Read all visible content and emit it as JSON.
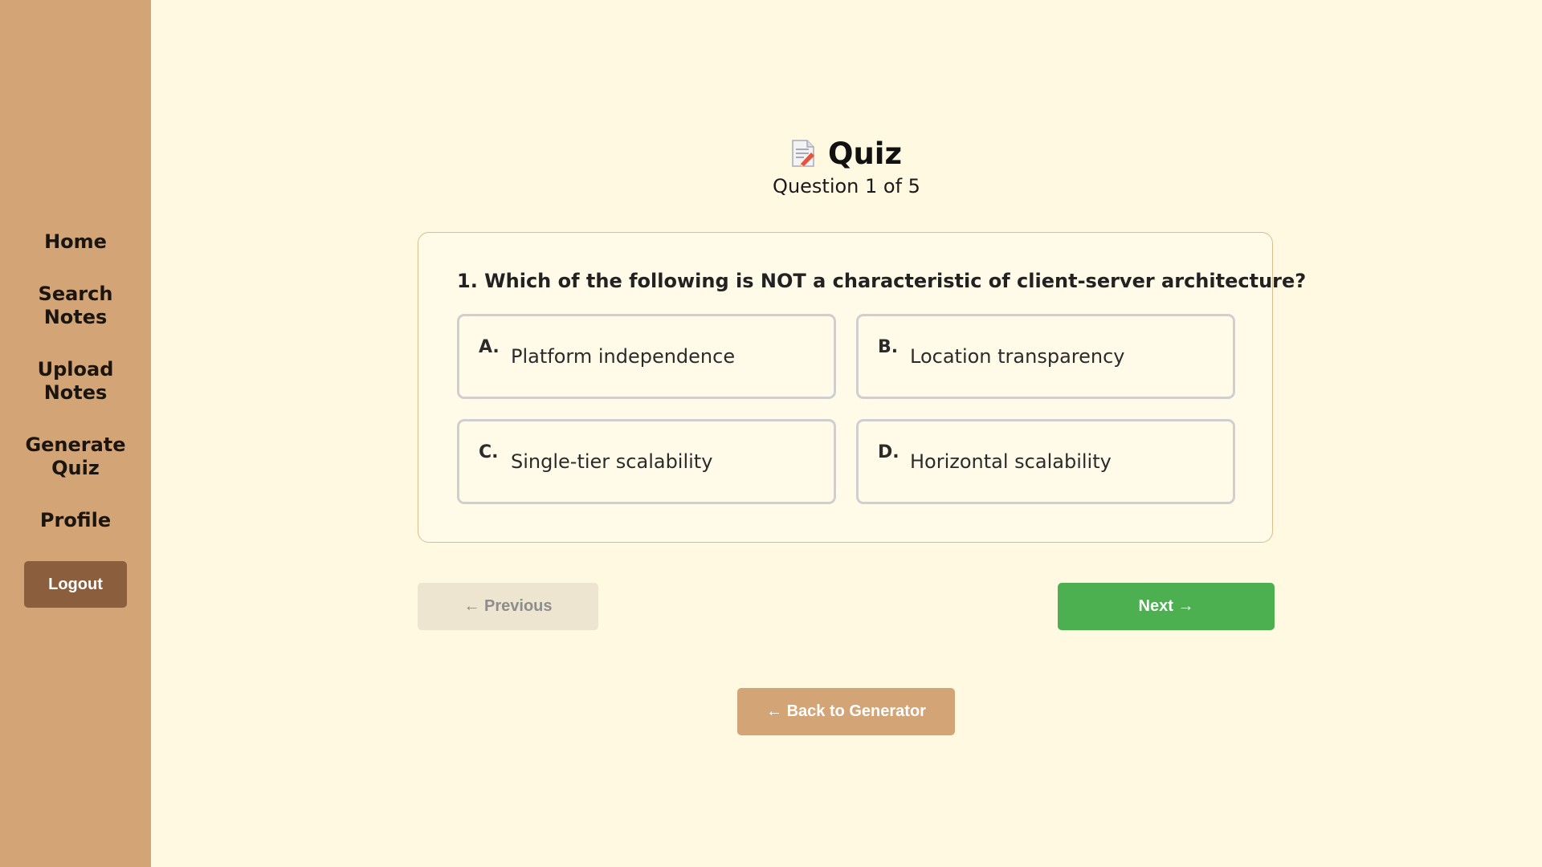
{
  "sidebar": {
    "items": [
      {
        "label": "Home"
      },
      {
        "label": "Search Notes"
      },
      {
        "label": "Upload Notes"
      },
      {
        "label": "Generate Quiz"
      },
      {
        "label": "Profile"
      }
    ],
    "logout_label": "Logout"
  },
  "quiz": {
    "icon": "memo-icon",
    "title": "Quiz",
    "progress": "Question 1 of 5",
    "question": "1. Which of the following is NOT a characteristic of client-server architecture?",
    "options": [
      {
        "letter": "A.",
        "text": "Platform independence"
      },
      {
        "letter": "B.",
        "text": "Location transparency"
      },
      {
        "letter": "C.",
        "text": "Single-tier scalability"
      },
      {
        "letter": "D.",
        "text": "Horizontal scalability"
      }
    ]
  },
  "nav": {
    "previous_label": "← Previous",
    "next_label": "Next →",
    "back_label": "← Back to Generator"
  },
  "colors": {
    "background": "#fff9e1",
    "sidebar": "#d3a475",
    "logout": "#8b5e3d",
    "next": "#4caf50",
    "previous_disabled": "#ede5cf",
    "back": "#d3a475"
  }
}
